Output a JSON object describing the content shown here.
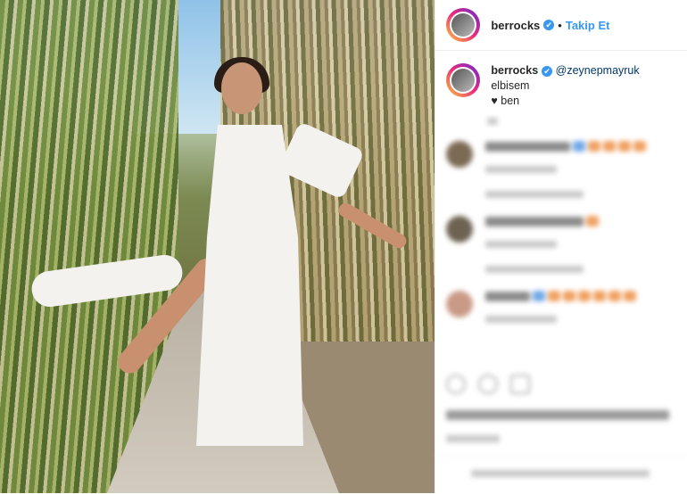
{
  "post": {
    "username": "berrocks",
    "verified_mark": "✔",
    "separator": "•",
    "follow_label": "Takip Et",
    "caption": {
      "username": "berrocks",
      "mention": "@zeynepmayruk",
      "text_after_mention": " elbisem",
      "second_line_heart": "♥",
      "second_line_text": " ben"
    }
  },
  "colors": {
    "link_blue": "#3897f0",
    "text_dark": "#262626",
    "mention": "#00376b",
    "muted": "#8e8e8e"
  },
  "icons": [
    "heart-icon",
    "comment-icon",
    "share-icon",
    "verified-badge-icon"
  ]
}
